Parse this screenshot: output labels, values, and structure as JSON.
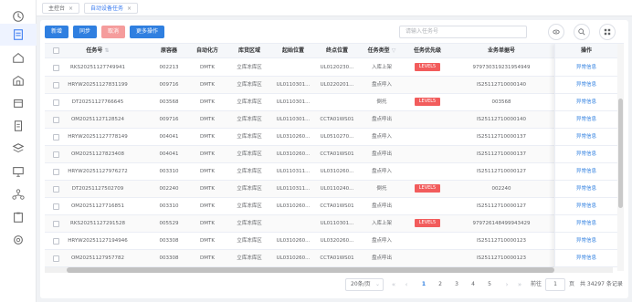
{
  "tabs": [
    {
      "label": "主控台",
      "active": false
    },
    {
      "label": "自动设备任务",
      "active": true
    }
  ],
  "toolbar": {
    "add": "新增",
    "sync": "同步",
    "cancel": "取消",
    "more": "更多操作",
    "search_placeholder": "请输入任务号"
  },
  "columns": [
    "任务号",
    "原容器",
    "自动化方",
    "库货区域",
    "起始位置",
    "终点位置",
    "任务类型",
    "任务优先级",
    "业务单据号",
    "操作"
  ],
  "rows": [
    {
      "task": "RKS20251127749941",
      "container": "002213",
      "auto": "DMTK",
      "area": "立库冻库区",
      "start": "",
      "end": "UL0120230...",
      "type": "入库上架",
      "priority": "LEVEL5",
      "doc": "979730319231954949",
      "op": "异常信息"
    },
    {
      "task": "HRYW20251127831199",
      "container": "009716",
      "auto": "DMTK",
      "area": "立库冻库区",
      "start": "UL0110301...",
      "end": "UL0220201...",
      "type": "盘点呼入",
      "priority": "",
      "doc": "IS25112710000140",
      "op": "异常信息"
    },
    {
      "task": "DT20251127766645",
      "container": "003568",
      "auto": "DMTK",
      "area": "立库冻库区",
      "start": "UL0110301...",
      "end": "",
      "type": "倒托",
      "priority": "LEVEL5",
      "doc": "003568",
      "op": "异常信息"
    },
    {
      "task": "OM20251127128524",
      "container": "009716",
      "auto": "DMTK",
      "area": "立库冻库区",
      "start": "UL0110301...",
      "end": "CCTA01WS01",
      "type": "盘点呼出",
      "priority": "",
      "doc": "IS25112710000140",
      "op": "异常信息"
    },
    {
      "task": "HRYW20251127778149",
      "container": "004041",
      "auto": "DMTK",
      "area": "立库冻库区",
      "start": "UL0310260...",
      "end": "UL0510270...",
      "type": "盘点呼入",
      "priority": "",
      "doc": "IS25112710000137",
      "op": "异常信息"
    },
    {
      "task": "OM20251127823408",
      "container": "004041",
      "auto": "DMTK",
      "area": "立库冻库区",
      "start": "UL0310260...",
      "end": "CCTA01WS01",
      "type": "盘点呼出",
      "priority": "",
      "doc": "IS25112710000137",
      "op": "异常信息"
    },
    {
      "task": "HRYW20251127976272",
      "container": "003310",
      "auto": "DMTK",
      "area": "立库冻库区",
      "start": "UL0110311...",
      "end": "UL0310260...",
      "type": "盘点呼入",
      "priority": "",
      "doc": "IS25112710000127",
      "op": "异常信息"
    },
    {
      "task": "DT20251127502709",
      "container": "002240",
      "auto": "DMTK",
      "area": "立库冻库区",
      "start": "UL0110311...",
      "end": "UL0110240...",
      "type": "倒托",
      "priority": "LEVEL5",
      "doc": "002240",
      "op": "异常信息"
    },
    {
      "task": "OM20251127716851",
      "container": "003310",
      "auto": "DMTK",
      "area": "立库冻库区",
      "start": "UL0310260...",
      "end": "CCTA01WS01",
      "type": "盘点呼出",
      "priority": "",
      "doc": "IS25112710000127",
      "op": "异常信息"
    },
    {
      "task": "RKS20251127291528",
      "container": "005529",
      "auto": "DMTK",
      "area": "立库冻库区",
      "start": "",
      "end": "UL0110301...",
      "type": "入库上架",
      "priority": "LEVEL5",
      "doc": "979726148499943429",
      "op": "异常信息"
    },
    {
      "task": "HRYW20251127194946",
      "container": "003308",
      "auto": "DMTK",
      "area": "立库冻库区",
      "start": "UL0310260...",
      "end": "UL0320260...",
      "type": "盘点呼入",
      "priority": "",
      "doc": "IS25112710000123",
      "op": "异常信息"
    },
    {
      "task": "OM20251127957782",
      "container": "003308",
      "auto": "DMTK",
      "area": "立库冻库区",
      "start": "UL0310260...",
      "end": "CCTA01WS01",
      "type": "盘点呼出",
      "priority": "",
      "doc": "IS25112710000123",
      "op": "异常信息"
    }
  ],
  "pagination": {
    "page_size": "20条/页",
    "pages": [
      "1",
      "2",
      "3",
      "4",
      "5"
    ],
    "current_page": "1",
    "goto_label": "前往",
    "goto_value": "1",
    "page_unit": "页",
    "total": "共 34297 条记录"
  },
  "colors": {
    "primary": "#2f7fe0",
    "danger": "#f25c5c",
    "cancel": "#f59c9c"
  }
}
